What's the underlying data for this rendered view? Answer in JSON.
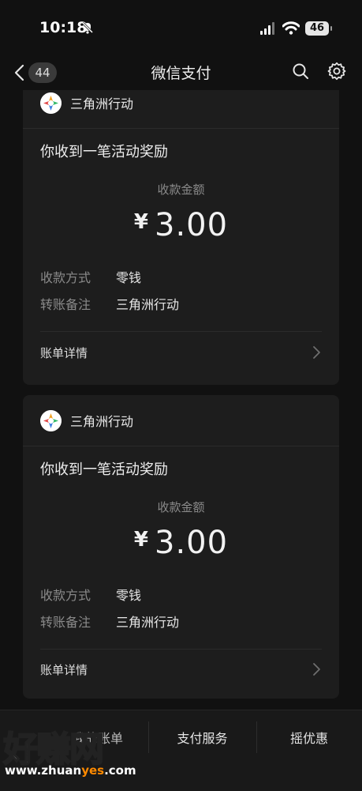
{
  "status_bar": {
    "time": "10:18",
    "battery": "46"
  },
  "nav": {
    "back_count": "44",
    "title": "微信支付"
  },
  "cards": [
    {
      "sender": "三角洲行动",
      "message": "你收到一笔活动奖励",
      "amount_label": "收款金额",
      "currency": "¥",
      "amount": "3.00",
      "rows": [
        {
          "label": "收款方式",
          "value": "零钱"
        },
        {
          "label": "转账备注",
          "value": "三角洲行动"
        }
      ],
      "detail_link": "账单详情"
    },
    {
      "sender": "三角洲行动",
      "message": "你收到一笔活动奖励",
      "amount_label": "收款金额",
      "currency": "¥",
      "amount": "3.00",
      "rows": [
        {
          "label": "收款方式",
          "value": "零钱"
        },
        {
          "label": "转账备注",
          "value": "三角洲行动"
        }
      ],
      "detail_link": "账单详情"
    }
  ],
  "bottom_tabs": [
    {
      "label": "我的账单"
    },
    {
      "label": "支付服务"
    },
    {
      "label": "摇优惠"
    }
  ],
  "watermark": {
    "big": "好赚网",
    "url_pre": "www.zhuan",
    "url_hl": "yes",
    "url_post": ".com"
  },
  "colors": {
    "background": "#111111",
    "card": "#1d1d1d",
    "muted": "#8a8a8a",
    "watermark_accent": "#ff8a00"
  }
}
